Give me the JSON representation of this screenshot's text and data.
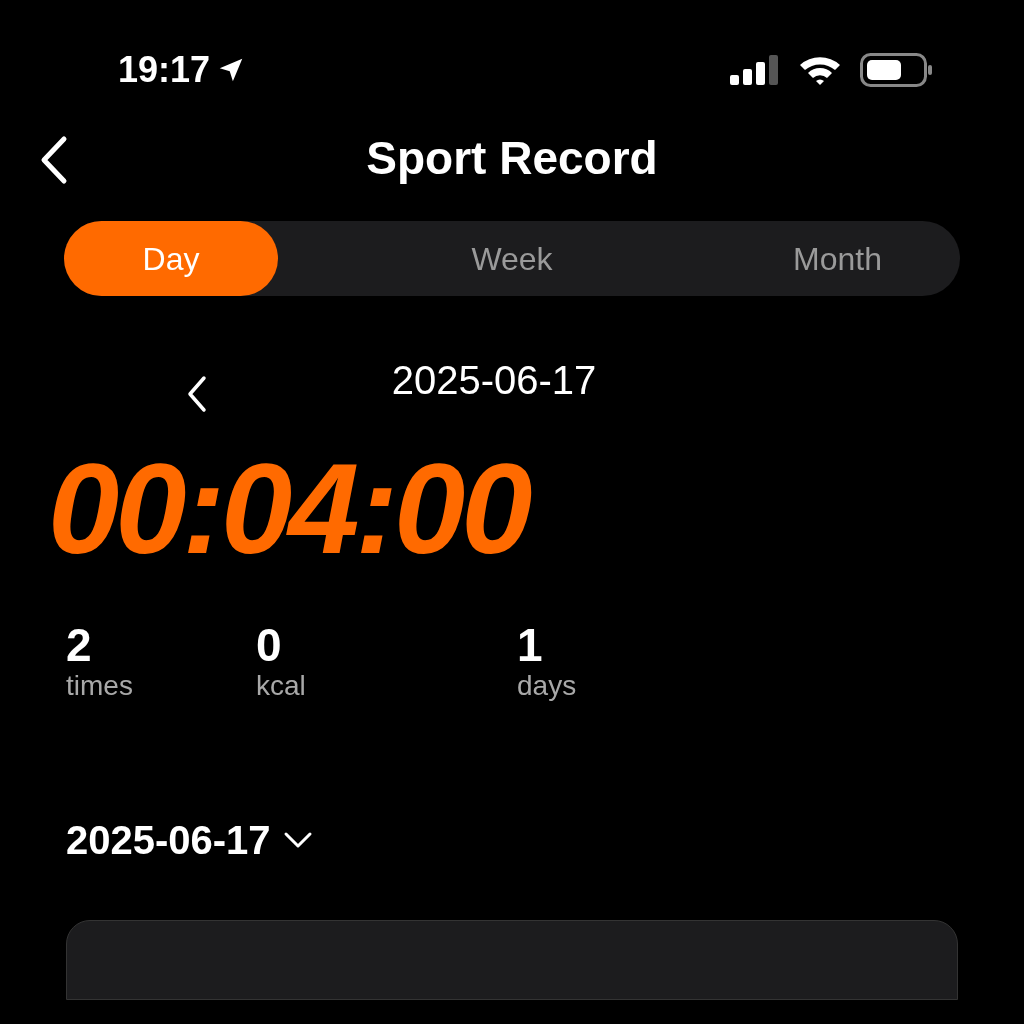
{
  "status_bar": {
    "time": "19:17"
  },
  "nav": {
    "title": "Sport Record"
  },
  "tabs": [
    {
      "label": "Day",
      "selected": true
    },
    {
      "label": "Week",
      "selected": false
    },
    {
      "label": "Month",
      "selected": false
    }
  ],
  "date_nav": {
    "date": "2025-06-17"
  },
  "total_duration": "00:04:00",
  "stats": [
    {
      "value": "2",
      "unit": "times"
    },
    {
      "value": "0",
      "unit": "kcal"
    },
    {
      "value": "1",
      "unit": "days"
    }
  ],
  "date_picker": {
    "value": "2025-06-17"
  }
}
